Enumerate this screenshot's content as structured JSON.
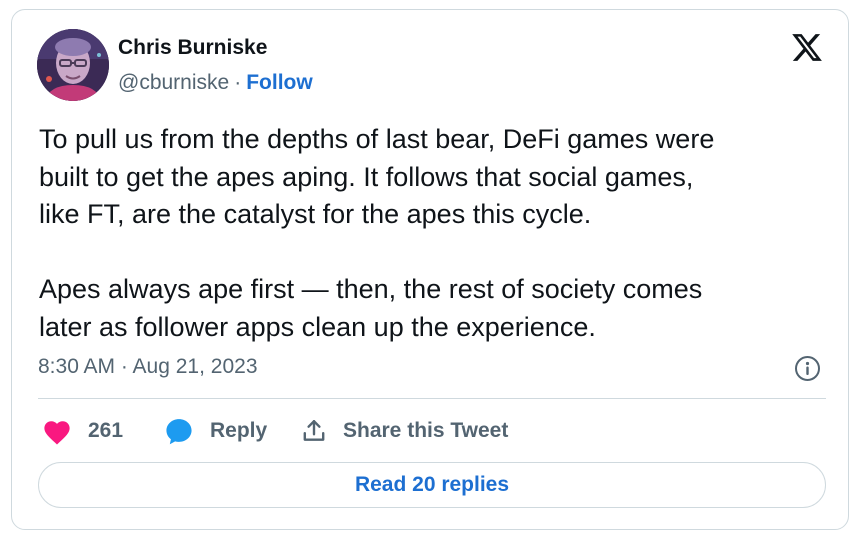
{
  "author": {
    "name": "Chris Burniske",
    "handle": "@cburniske",
    "separator": "·",
    "follow_label": "Follow"
  },
  "tweet": {
    "text": "To pull us from the depths of last bear, DeFi games were\nbuilt to get the apes aping. It follows that social games,\nlike FT, are the catalyst for the apes this cycle.\n\nApes always ape first — then, the rest of society comes\nlater as follower apps clean up the experience.",
    "timestamp": "8:30 AM · Aug 21, 2023"
  },
  "actions": {
    "like_count": "261",
    "reply_label": "Reply",
    "share_label": "Share this Tweet"
  },
  "read_replies_label": "Read 20 replies",
  "icons": {
    "brand": "x-logo-icon",
    "info": "info-icon",
    "like": "heart-icon",
    "reply": "speech-bubble-icon",
    "share": "share-upload-icon"
  },
  "colors": {
    "link": "#1d6fd1",
    "like": "#f91880",
    "reply": "#1d9bf0",
    "secondary_text": "#536471",
    "border": "#cfd9de"
  }
}
